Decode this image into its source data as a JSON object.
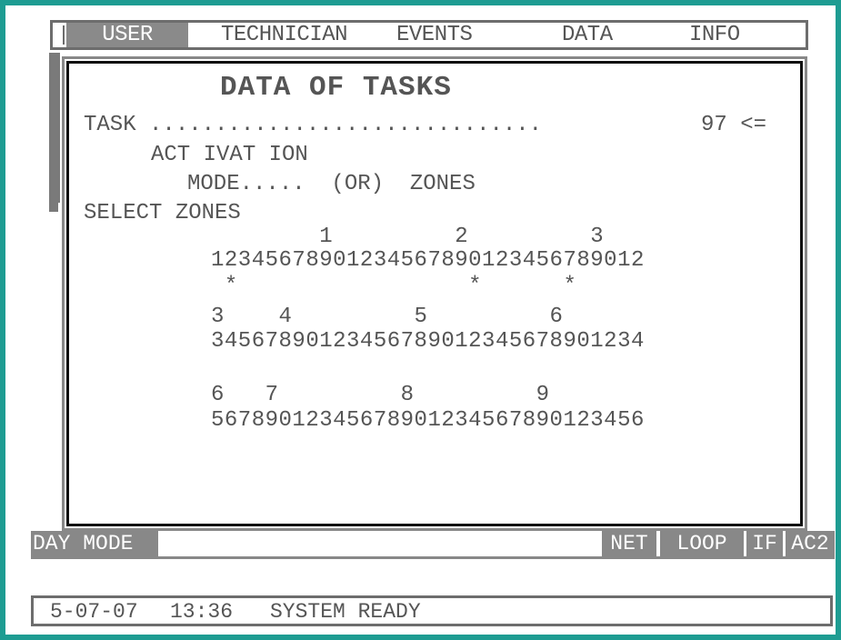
{
  "menu": {
    "user": "USER",
    "technician": "TECHNICIAN",
    "events": "EVENTS",
    "data": "DATA",
    "info": "INFO"
  },
  "panel": {
    "title": "DATA OF TASKS",
    "task_label": "TASK ..............................",
    "task_value": "97 <=",
    "activation_label": "ACT IVAT ION",
    "mode_line": "MODE.....  (OR)  ZONES",
    "select_zones_label": "SELECT ZONES",
    "zone_rows": [
      {
        "tens": "        1         2         3",
        "units": "12345678901234567890123456789012",
        "marks": " *                 *      *"
      },
      {
        "tens": "3    4         5         6",
        "units": "34567890123456789012345678901234",
        "marks": ""
      },
      {
        "tens": "6   7         8         9",
        "units": "56789012345678901234567890123456",
        "marks": ""
      }
    ]
  },
  "status": {
    "day_mode": "DAY MODE",
    "net": "NET",
    "loop": "LOOP",
    "if": "IF",
    "ac2": "AC2"
  },
  "statusline": {
    "date": "5-07-07",
    "time": "13:36",
    "message": "SYSTEM READY"
  },
  "colors": {
    "frame": "#1e9c92",
    "highlight": "#8a8a8a"
  }
}
